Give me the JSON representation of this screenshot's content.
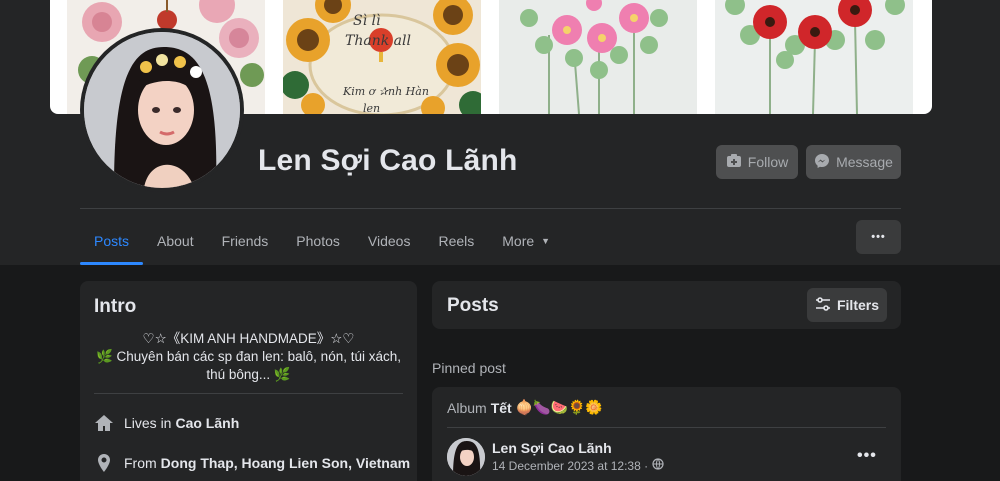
{
  "profile": {
    "name": "Len Sợi Cao Lãnh"
  },
  "cover": {
    "tiles": [
      {
        "name": "pink-roses-wreath",
        "text": ""
      },
      {
        "name": "sunflower-wreath",
        "text_top": "Sì lì",
        "text_mid": "Thank all",
        "text_bot": "Kim ơ ✰nh Hàn len"
      },
      {
        "name": "pink-flowers-bouquet",
        "text": ""
      },
      {
        "name": "red-flowers-bouquet",
        "text": ""
      }
    ]
  },
  "actions": {
    "follow_label": "Follow",
    "message_label": "Message",
    "more_label": "•••"
  },
  "tabs": [
    {
      "label": "Posts",
      "active": true
    },
    {
      "label": "About",
      "active": false
    },
    {
      "label": "Friends",
      "active": false
    },
    {
      "label": "Photos",
      "active": false
    },
    {
      "label": "Videos",
      "active": false
    },
    {
      "label": "Reels",
      "active": false
    },
    {
      "label": "More",
      "active": false
    }
  ],
  "intro": {
    "title": "Intro",
    "bio_line1": "♡☆《KIM ANH HANDMADE》☆♡",
    "bio_line2": "🌿 Chuyên bán các sp đan len: balô, nón, túi xách,",
    "bio_line3": "thú bông... 🌿",
    "lives_prefix": "Lives in",
    "lives_value": "Cao Lãnh",
    "from_prefix": "From",
    "from_value": "Dong Thap, Hoang Lien Son, Vietnam"
  },
  "posts": {
    "title": "Posts",
    "filters_label": "Filters",
    "pinned_label": "Pinned post",
    "album_prefix": "Album",
    "album_name": "Tết",
    "album_emojis": "🧅🍆🍉🌻🌼",
    "author": "Len Sợi Cao Lãnh",
    "timestamp": "14 December 2023 at 12:38 ·",
    "options_label": "•••"
  },
  "colors": {
    "accent": "#2d88ff",
    "background": "#18191a",
    "card": "#242526",
    "button": "#4e4f50"
  }
}
